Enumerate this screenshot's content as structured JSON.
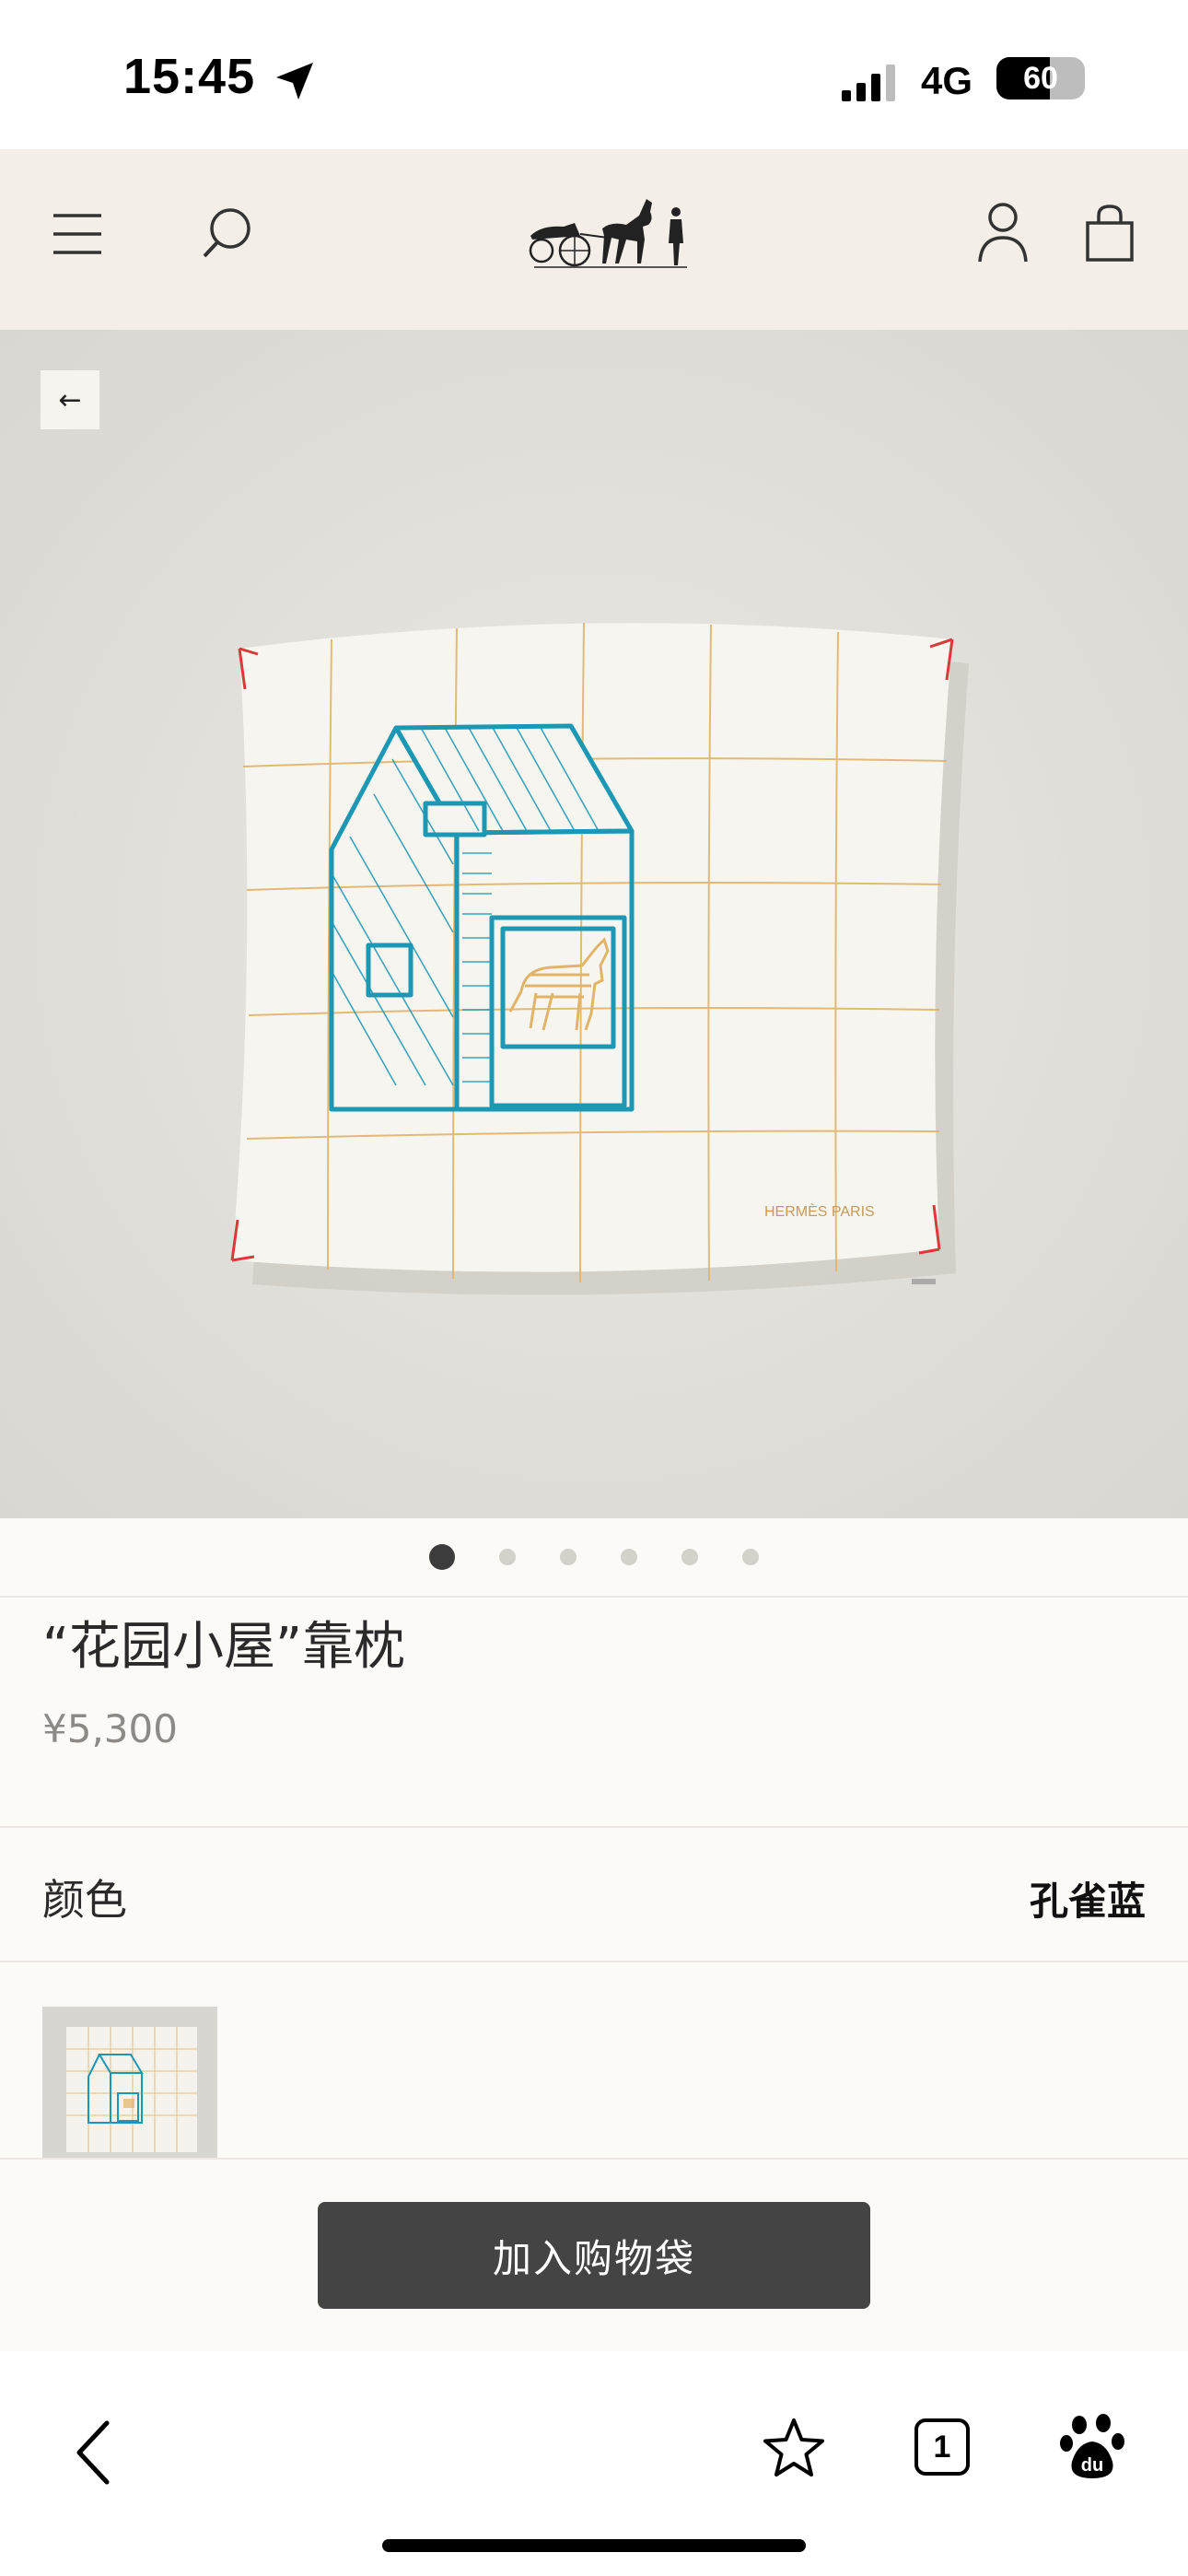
{
  "status_bar": {
    "time": "15:45",
    "network": "4G",
    "battery_level": 60,
    "battery_text": "60"
  },
  "header": {
    "menu_icon": "menu-icon",
    "search_icon": "search-icon",
    "logo": "hermes-carriage-logo",
    "account_icon": "account-icon",
    "bag_icon": "shopping-bag-icon"
  },
  "hero": {
    "back_glyph": "←",
    "pillow_signature": "HERMÈS PARIS",
    "slide_count": 6,
    "active_slide": 1
  },
  "product": {
    "title": "“花园小屋”靠枕",
    "price": "¥5,300"
  },
  "color": {
    "label": "颜色",
    "value": "孔雀蓝"
  },
  "cta": {
    "add_to_bag": "加入购物袋"
  },
  "browser": {
    "tab_count": "1",
    "back_icon": "chevron-left-icon",
    "bookmark_icon": "star-icon",
    "tabs_icon": "tabs-icon",
    "baidu_icon": "baidu-paw-icon"
  },
  "colors": {
    "header_bg": "#f3efe8",
    "page_bg": "#fcfaf6",
    "button_bg": "#444444",
    "stitch_teal": "#1c97b4",
    "stitch_gold": "#e1b468",
    "edge_red": "#d83a3a"
  }
}
